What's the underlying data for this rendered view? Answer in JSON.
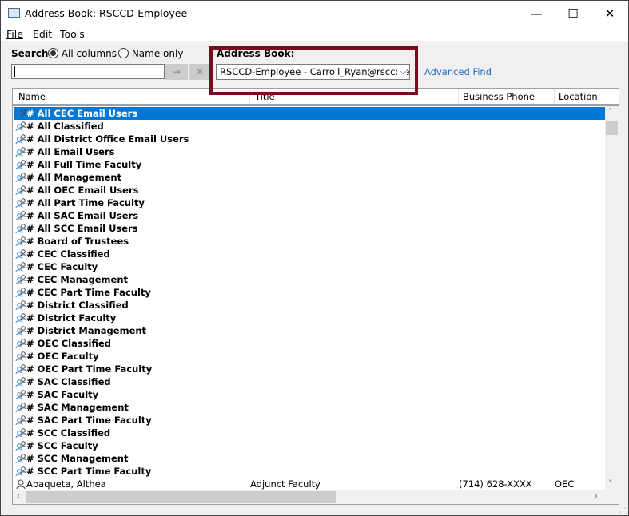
{
  "window": {
    "title": "Address Book: RSCCD-Employee",
    "controls": [
      "minimize",
      "maximize",
      "close"
    ]
  },
  "menu": [
    "File",
    "Edit",
    "Tools"
  ],
  "search": {
    "label": "Search:",
    "options": [
      {
        "label": "All columns",
        "selected": true
      },
      {
        "label": "Name only",
        "selected": false
      }
    ],
    "value": "",
    "go_icon": "arrow-right-icon",
    "clear_icon": "x-icon"
  },
  "address_book": {
    "label": "Address Book:",
    "selected": "RSCCD-Employee - Carroll_Ryan@rsccd.edu",
    "advanced_find": "Advanced Find",
    "highlight_color": "#7b0a1e"
  },
  "columns": [
    "Name",
    "Title",
    "Business Phone",
    "Location"
  ],
  "rows": [
    {
      "name": "# All CEC Email Users",
      "type": "group",
      "selected": true
    },
    {
      "name": "# All Classified",
      "type": "group"
    },
    {
      "name": "# All District Office Email Users",
      "type": "group"
    },
    {
      "name": "# All Email Users",
      "type": "group"
    },
    {
      "name": "# All Full Time Faculty",
      "type": "group"
    },
    {
      "name": "# All Management",
      "type": "group"
    },
    {
      "name": "# All OEC Email Users",
      "type": "group"
    },
    {
      "name": "# All Part Time Faculty",
      "type": "group"
    },
    {
      "name": "# All SAC Email Users",
      "type": "group"
    },
    {
      "name": "# All SCC Email Users",
      "type": "group"
    },
    {
      "name": "# Board of Trustees",
      "type": "group"
    },
    {
      "name": "# CEC Classified",
      "type": "group"
    },
    {
      "name": "# CEC Faculty",
      "type": "group"
    },
    {
      "name": "# CEC Management",
      "type": "group"
    },
    {
      "name": "# CEC Part Time Faculty",
      "type": "group"
    },
    {
      "name": "# District Classified",
      "type": "group"
    },
    {
      "name": "# District Faculty",
      "type": "group"
    },
    {
      "name": "# District Management",
      "type": "group"
    },
    {
      "name": "# OEC Classified",
      "type": "group"
    },
    {
      "name": "# OEC Faculty",
      "type": "group"
    },
    {
      "name": "# OEC Part Time Faculty",
      "type": "group"
    },
    {
      "name": "# SAC Classified",
      "type": "group"
    },
    {
      "name": "# SAC Faculty",
      "type": "group"
    },
    {
      "name": "# SAC Management",
      "type": "group"
    },
    {
      "name": "# SAC Part Time Faculty",
      "type": "group"
    },
    {
      "name": "# SCC Classified",
      "type": "group"
    },
    {
      "name": "# SCC Faculty",
      "type": "group"
    },
    {
      "name": "# SCC Management",
      "type": "group"
    },
    {
      "name": "# SCC Part Time Faculty",
      "type": "group"
    },
    {
      "name": "Abaqueta, Althea",
      "type": "user",
      "title": "Adjunct Faculty",
      "phone": "(714) 628-XXXX",
      "location": "OEC"
    }
  ]
}
